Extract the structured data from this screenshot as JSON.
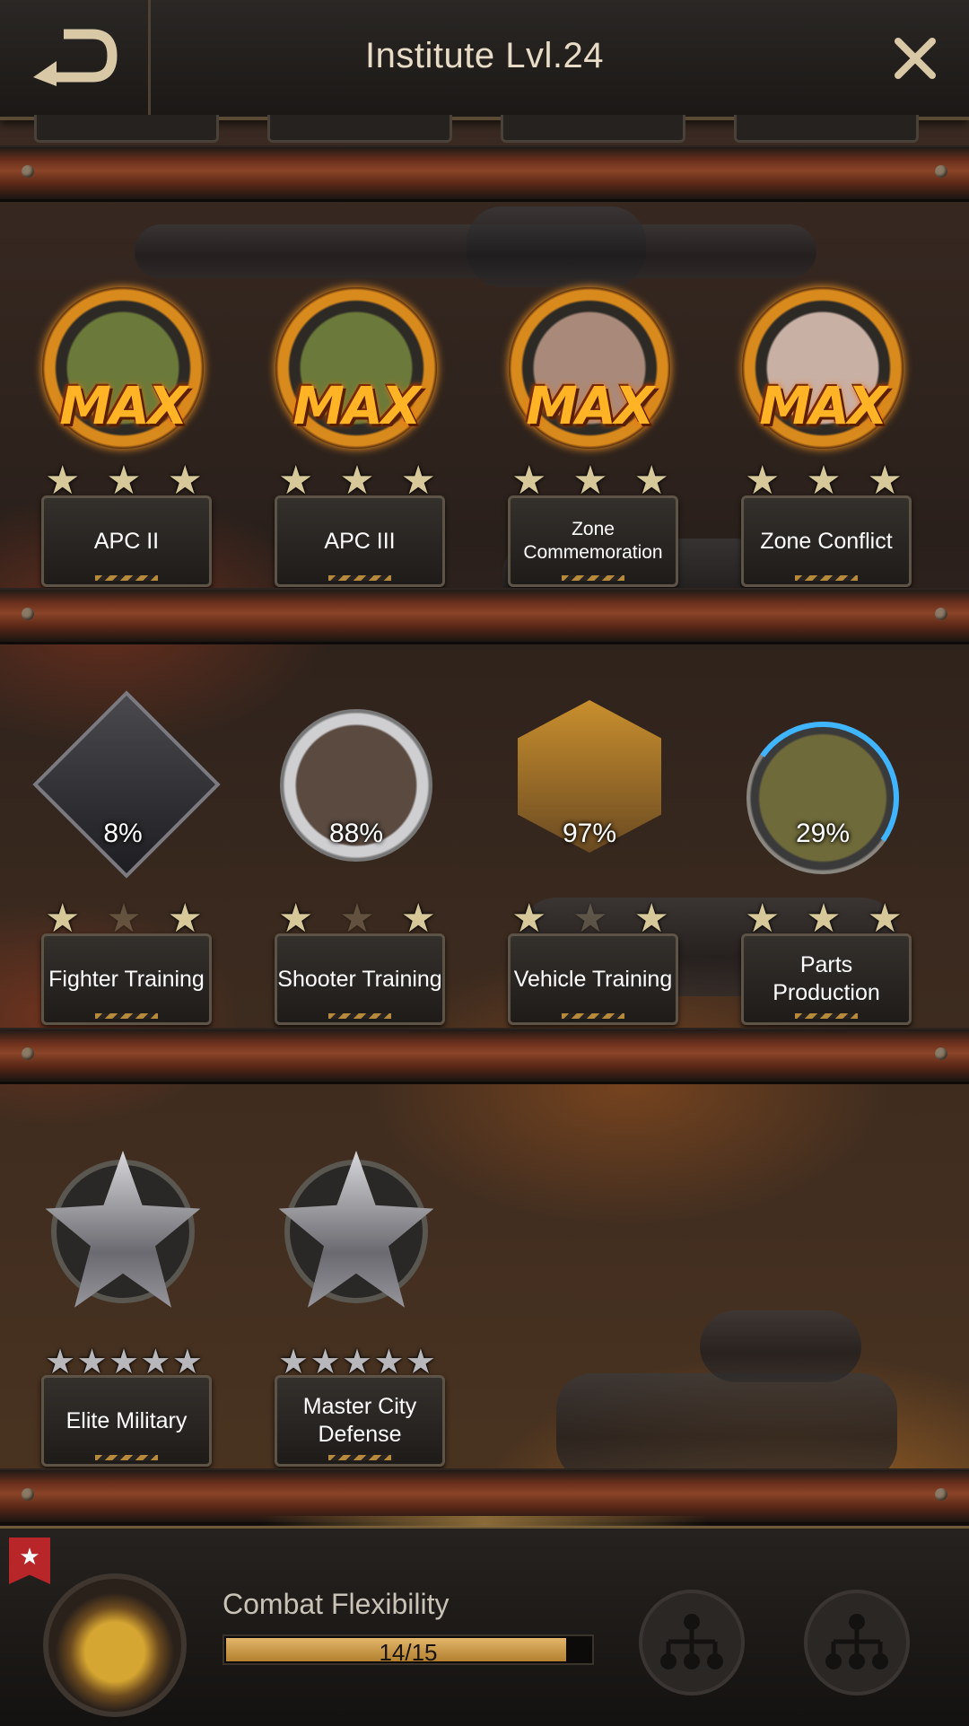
{
  "header": {
    "title": "Institute Lvl.24",
    "back_icon": "back-arrow-icon",
    "close_icon": "close-icon"
  },
  "rows": [
    {
      "cards": [
        {
          "name": "APC II",
          "status": "MAX",
          "stars": 3,
          "emblem": "apc-truck-icon"
        },
        {
          "name": "APC III",
          "status": "MAX",
          "stars": 3,
          "emblem": "apc-truck-icon"
        },
        {
          "name": "Zone Commemoration",
          "status": "MAX",
          "stars": 3,
          "emblem": "city-zone-icon"
        },
        {
          "name": "Zone Conflict",
          "status": "MAX",
          "stars": 3,
          "emblem": "flag-map-icon"
        }
      ]
    },
    {
      "cards": [
        {
          "name": "Fighter Training",
          "progress": "8%",
          "stars": 2,
          "emblem": "fighter-helmet-icon"
        },
        {
          "name": "Shooter Training",
          "progress": "88%",
          "stars": 2,
          "emblem": "sniper-icon"
        },
        {
          "name": "Vehicle Training",
          "progress": "97%",
          "stars": 2,
          "emblem": "armored-bus-icon"
        },
        {
          "name": "Parts Production",
          "progress": "29%",
          "stars": 3,
          "emblem": "crane-truck-icon"
        }
      ]
    },
    {
      "cards": [
        {
          "name": "Elite Military",
          "stars": 0,
          "emblem": "crossed-swords-star-icon"
        },
        {
          "name": "Master City Defense",
          "stars": 0,
          "emblem": "shield-star-icon"
        }
      ]
    }
  ],
  "bottom": {
    "skill_name": "Combat Flexibility",
    "progress_text": "14/15",
    "progress_fraction": 0.933,
    "badge_icon": "star-ribbon-icon",
    "tree_icon": "skill-tree-icon"
  }
}
